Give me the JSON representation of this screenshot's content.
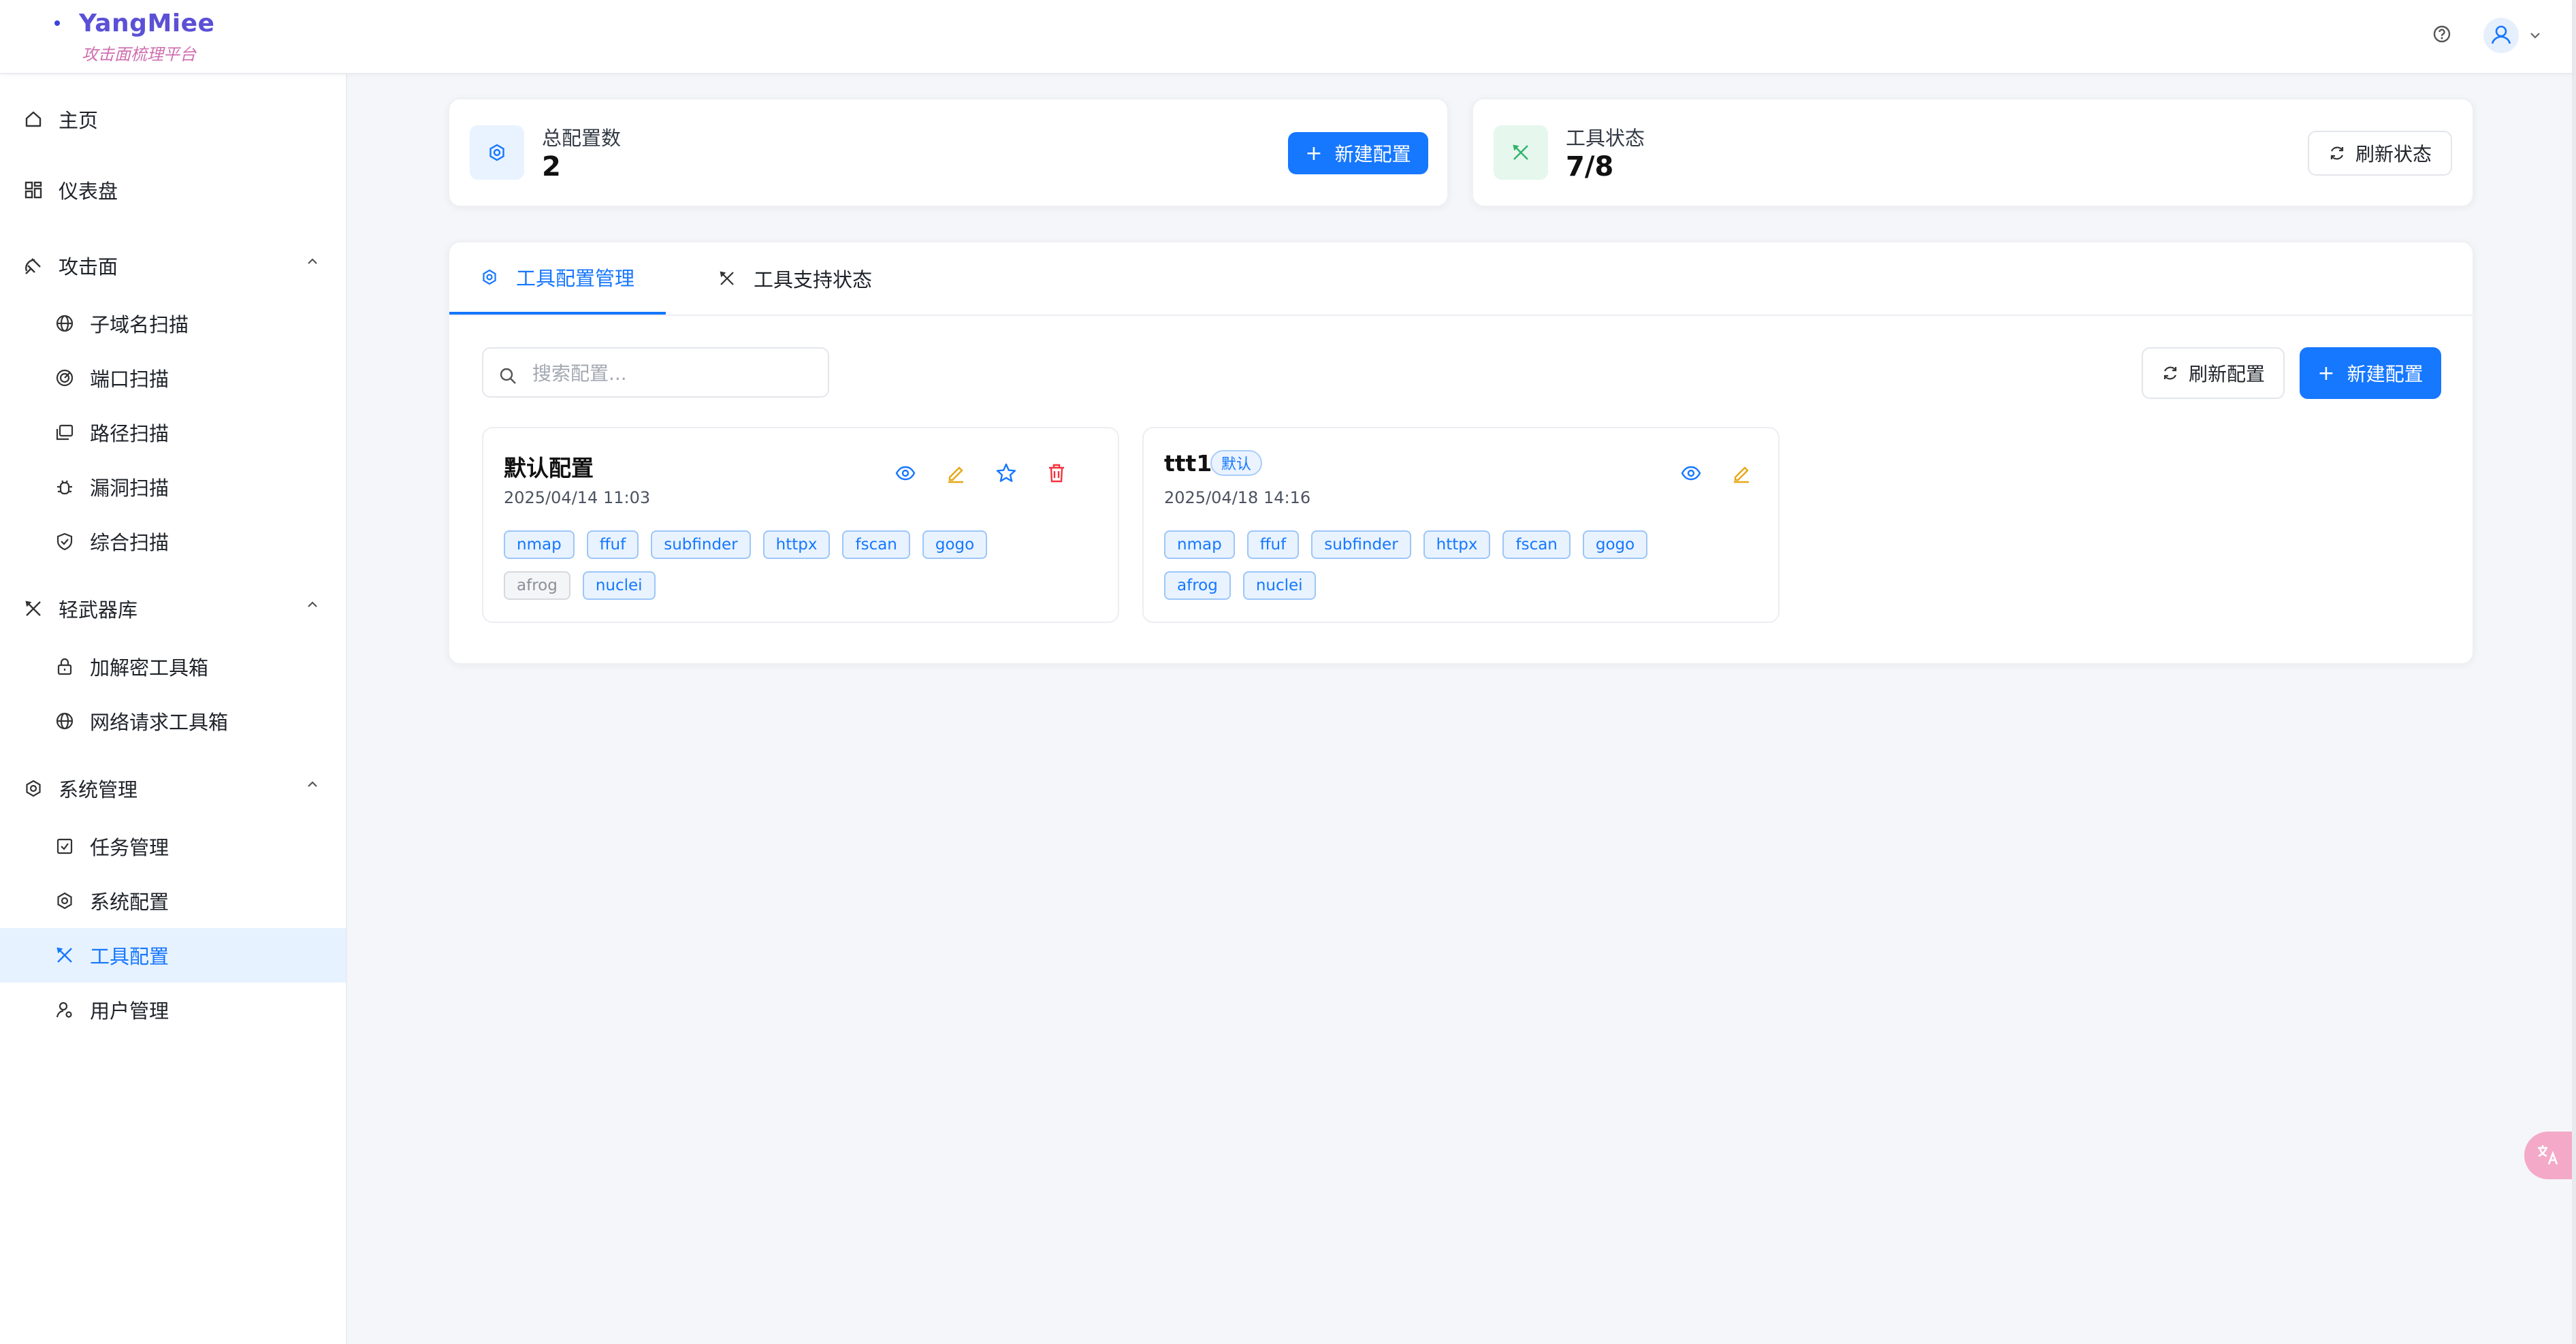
{
  "brand": {
    "name": "YangMiee",
    "subtitle": "攻击面梳理平台"
  },
  "sidebar": {
    "items": [
      {
        "label": "主页",
        "icon": "home-icon"
      },
      {
        "label": "仪表盘",
        "icon": "dashboard-icon"
      },
      {
        "label": "攻击面",
        "icon": "attack-surface-icon",
        "expanded": true,
        "children": [
          {
            "label": "子域名扫描",
            "icon": "globe-icon"
          },
          {
            "label": "端口扫描",
            "icon": "radar-icon"
          },
          {
            "label": "路径扫描",
            "icon": "folder-icon"
          },
          {
            "label": "漏洞扫描",
            "icon": "bug-icon"
          },
          {
            "label": "综合扫描",
            "icon": "shield-check-icon"
          }
        ]
      },
      {
        "label": "轻武器库",
        "icon": "tools-icon",
        "expanded": true,
        "children": [
          {
            "label": "加解密工具箱",
            "icon": "lock-icon"
          },
          {
            "label": "网络请求工具箱",
            "icon": "globe-icon"
          }
        ]
      },
      {
        "label": "系统管理",
        "icon": "gear-icon",
        "expanded": true,
        "children": [
          {
            "label": "任务管理",
            "icon": "checkbox-icon"
          },
          {
            "label": "系统配置",
            "icon": "gear-icon"
          },
          {
            "label": "工具配置",
            "icon": "tools-icon",
            "active": true
          },
          {
            "label": "用户管理",
            "icon": "user-gear-icon"
          }
        ]
      }
    ]
  },
  "stats": {
    "total": {
      "label": "总配置数",
      "value": "2",
      "button": "新建配置"
    },
    "tools": {
      "label": "工具状态",
      "value": "7/8",
      "button": "刷新状态"
    }
  },
  "tabs": [
    {
      "label": "工具配置管理",
      "active": true
    },
    {
      "label": "工具支持状态",
      "active": false
    }
  ],
  "toolbar": {
    "search_placeholder": "搜索配置...",
    "refresh_label": "刷新配置",
    "new_label": "新建配置"
  },
  "configs": [
    {
      "name": "默认配置",
      "date": "2025/04/14 11:03",
      "is_default": false,
      "tools": [
        {
          "name": "nmap",
          "enabled": true
        },
        {
          "name": "ffuf",
          "enabled": true
        },
        {
          "name": "subfinder",
          "enabled": true
        },
        {
          "name": "httpx",
          "enabled": true
        },
        {
          "name": "fscan",
          "enabled": true
        },
        {
          "name": "gogo",
          "enabled": true
        },
        {
          "name": "afrog",
          "enabled": false
        },
        {
          "name": "nuclei",
          "enabled": true
        }
      ]
    },
    {
      "name": "ttt1",
      "badge": "默认",
      "date": "2025/04/18 14:16",
      "is_default": true,
      "tools": [
        {
          "name": "nmap",
          "enabled": true
        },
        {
          "name": "ffuf",
          "enabled": true
        },
        {
          "name": "subfinder",
          "enabled": true
        },
        {
          "name": "httpx",
          "enabled": true
        },
        {
          "name": "fscan",
          "enabled": true
        },
        {
          "name": "gogo",
          "enabled": true
        },
        {
          "name": "afrog",
          "enabled": true
        },
        {
          "name": "nuclei",
          "enabled": true
        }
      ]
    }
  ],
  "colors": {
    "primary": "#1677ff",
    "tag_border": "#9dc6f7",
    "tag_bg": "#e8f3ff",
    "danger": "#f5333f",
    "warning": "#e6a817",
    "success": "#2fb36b"
  }
}
